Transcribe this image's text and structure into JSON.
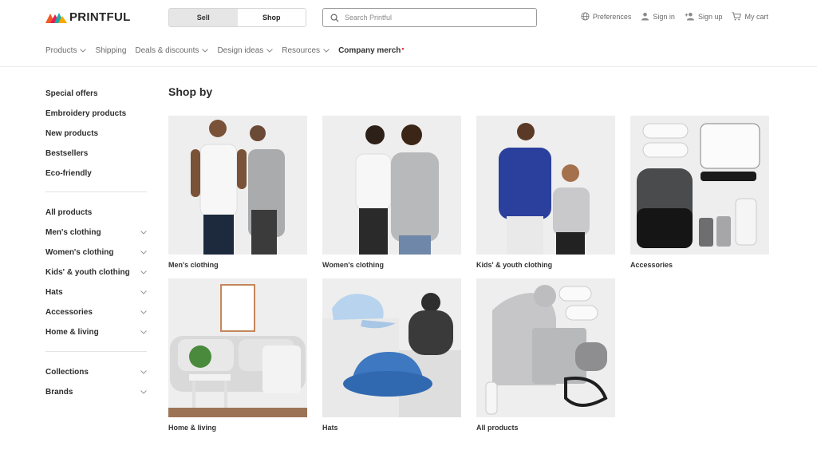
{
  "brand": {
    "name": "PRINTFUL"
  },
  "mode_toggle": {
    "sell_label": "Sell",
    "shop_label": "Shop",
    "selected": "Shop"
  },
  "search": {
    "placeholder": "Search Printful",
    "value": ""
  },
  "utility_links": [
    {
      "label": "Preferences",
      "icon": "globe-icon"
    },
    {
      "label": "Sign in",
      "icon": "user-icon"
    },
    {
      "label": "Sign up",
      "icon": "user-plus-icon"
    },
    {
      "label": "My cart",
      "icon": "cart-icon"
    }
  ],
  "nav": [
    {
      "label": "Products",
      "dropdown": true
    },
    {
      "label": "Shipping",
      "dropdown": false
    },
    {
      "label": "Deals & discounts",
      "dropdown": true
    },
    {
      "label": "Design ideas",
      "dropdown": true
    },
    {
      "label": "Resources",
      "dropdown": true
    },
    {
      "label": "Company merch",
      "dropdown": false,
      "dot": "•"
    }
  ],
  "sidebar": {
    "group1": [
      "Special offers",
      "Embroidery products",
      "New products",
      "Bestsellers",
      "Eco-friendly"
    ],
    "group2": [
      {
        "label": "All products",
        "expandable": false
      },
      {
        "label": "Men's clothing",
        "expandable": true
      },
      {
        "label": "Women's clothing",
        "expandable": true
      },
      {
        "label": "Kids' & youth clothing",
        "expandable": true
      },
      {
        "label": "Hats",
        "expandable": true
      },
      {
        "label": "Accessories",
        "expandable": true
      },
      {
        "label": "Home & living",
        "expandable": true
      }
    ],
    "group3": [
      {
        "label": "Collections",
        "expandable": true
      },
      {
        "label": "Brands",
        "expandable": true
      }
    ]
  },
  "main": {
    "title": "Shop by",
    "categories": [
      {
        "label": "Men's clothing"
      },
      {
        "label": "Women's clothing"
      },
      {
        "label": "Kids' & youth clothing"
      },
      {
        "label": "Accessories"
      },
      {
        "label": "Home & living"
      },
      {
        "label": "Hats"
      },
      {
        "label": "All products"
      }
    ]
  },
  "colors": {
    "accent_dot": "#e0303f",
    "card_bg": "#eeeeee",
    "text": "#2b2b2b"
  }
}
